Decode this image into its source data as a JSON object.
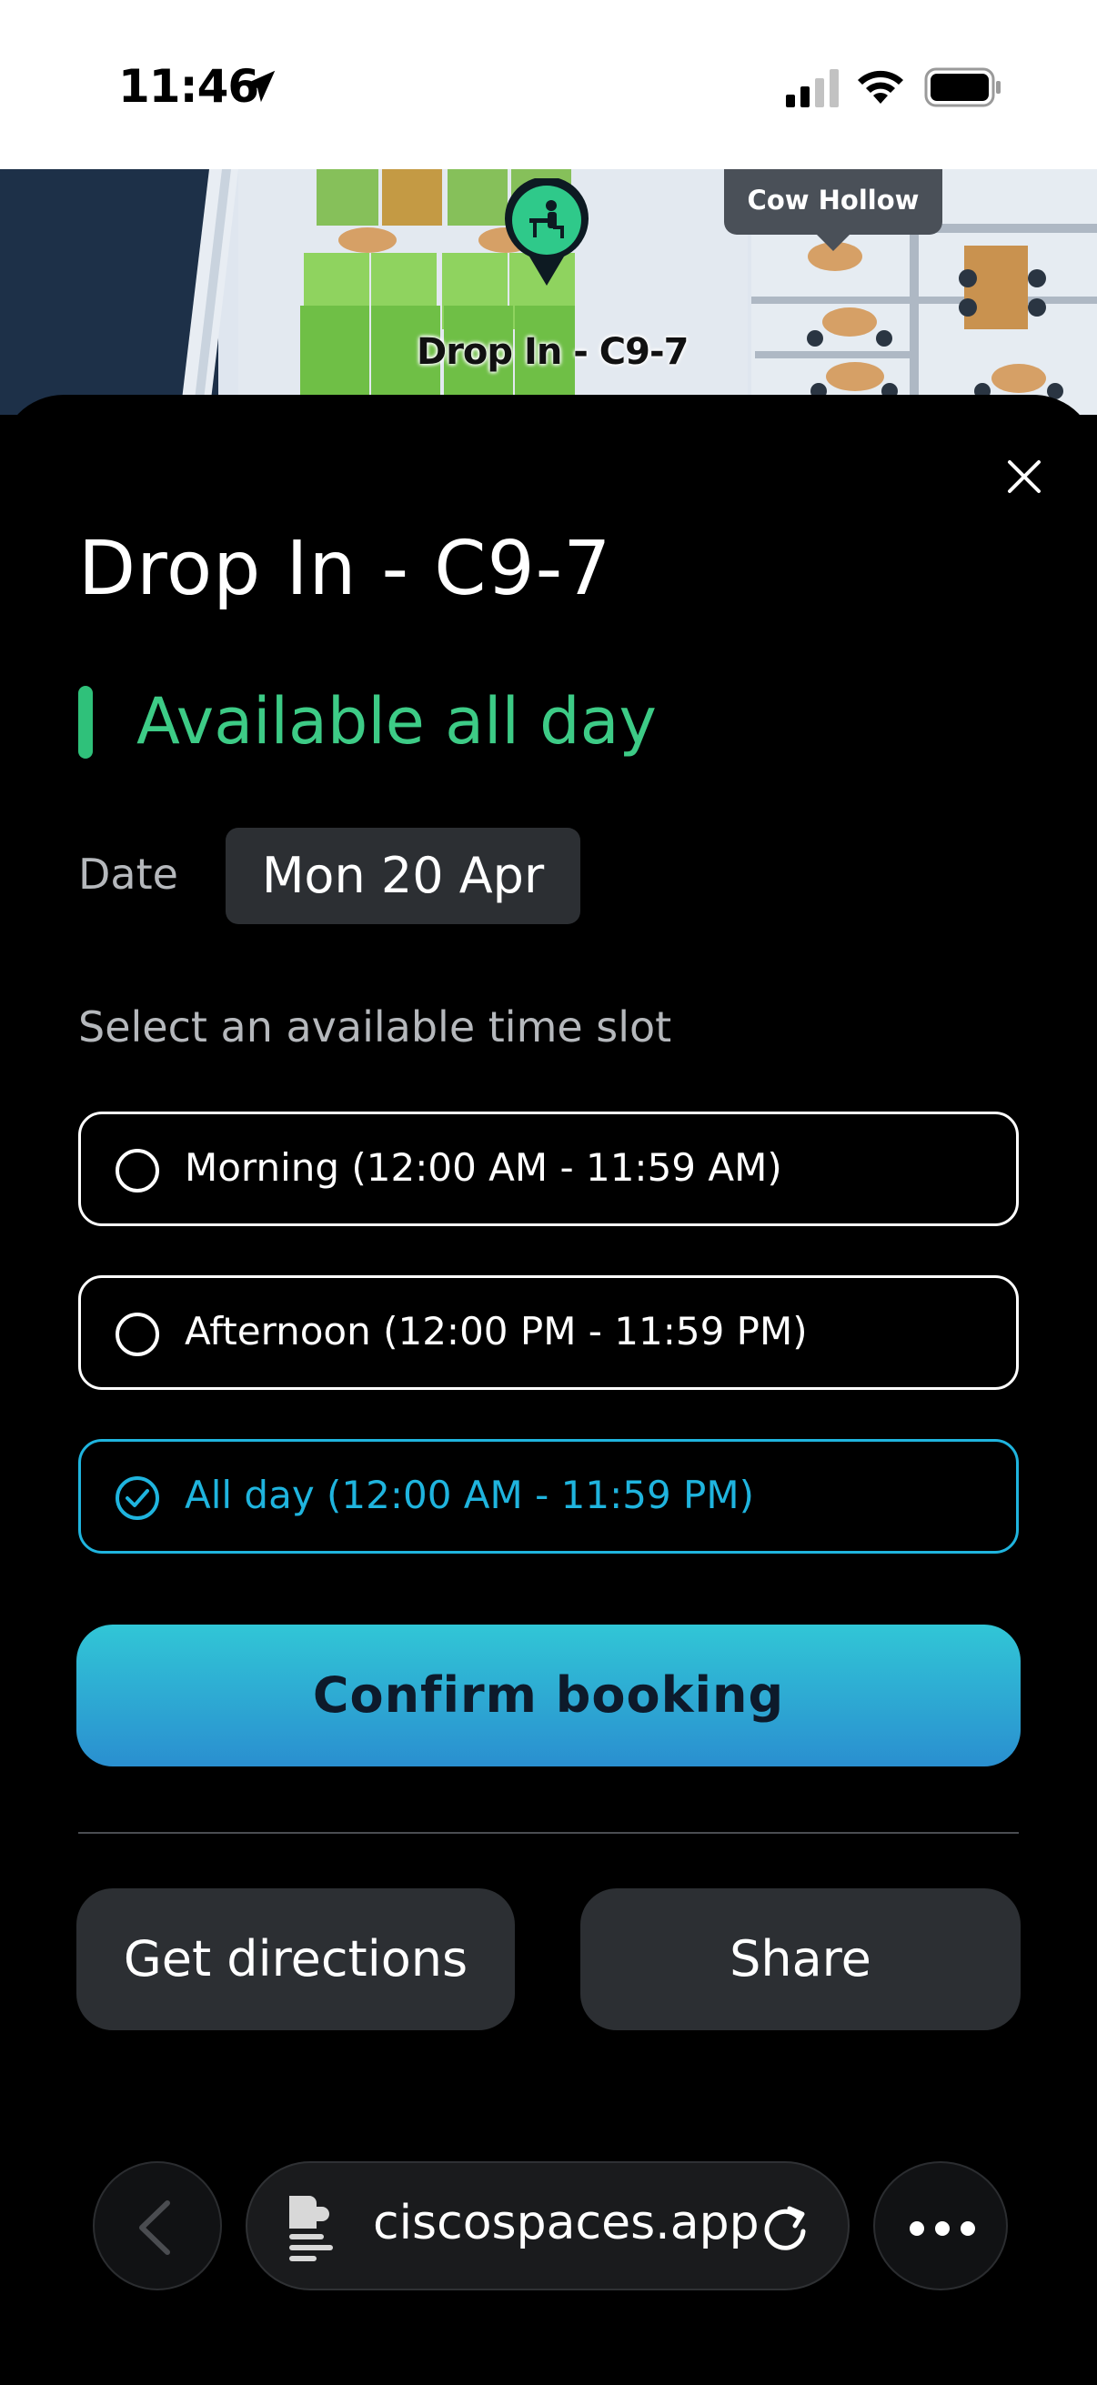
{
  "status_bar": {
    "time": "11:46"
  },
  "map": {
    "pin_label": "Drop In - C9-7",
    "area_label": "Cow Hollow"
  },
  "sheet": {
    "title": "Drop In - C9-7",
    "availability": "Available all day",
    "date_label": "Date",
    "date_value": "Mon 20 Apr",
    "slot_heading": "Select an available time slot",
    "slots": [
      {
        "label": "Morning (12:00 AM - 11:59 AM)",
        "selected": false
      },
      {
        "label": "Afternoon (12:00 PM - 11:59 PM)",
        "selected": false
      },
      {
        "label": "All day (12:00 AM - 11:59 PM)",
        "selected": true
      }
    ],
    "confirm_label": "Confirm booking",
    "directions_label": "Get directions",
    "share_label": "Share"
  },
  "browser": {
    "url": "ciscospaces.app"
  },
  "colors": {
    "available_green": "#3dcb86",
    "selected_blue": "#1fb4de",
    "confirm_gradient_top": "#31c6d6",
    "confirm_gradient_bottom": "#2a8fd0"
  },
  "icons": [
    "location-arrow-icon",
    "signal-icon",
    "wifi-icon",
    "battery-icon",
    "desk-icon",
    "close-icon",
    "radio-empty-icon",
    "check-circle-icon",
    "chevron-left-icon",
    "page-icon",
    "reload-icon",
    "more-icon"
  ]
}
